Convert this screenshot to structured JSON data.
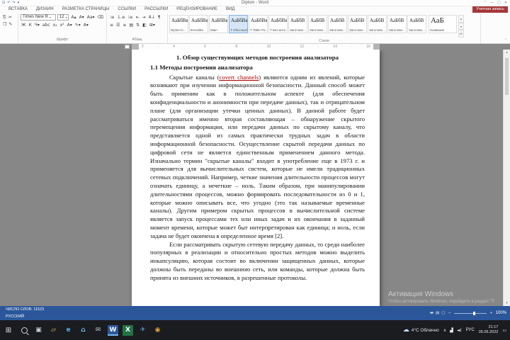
{
  "titlebar": {
    "title": "Diplom - Word",
    "qat": [
      {
        "g": "⊡",
        "n": "save-button"
      },
      {
        "g": "↶",
        "n": "undo-button"
      },
      {
        "g": "↷",
        "n": "redo-button"
      },
      {
        "g": "▾",
        "n": "qat-customize-button"
      }
    ],
    "controls": [
      {
        "g": "⌃",
        "n": "ribbon-display-options-button"
      },
      {
        "g": "—",
        "n": "minimize-button"
      },
      {
        "g": "▢",
        "n": "restore-button"
      },
      {
        "g": "✕",
        "n": "close-button"
      }
    ]
  },
  "ribbon": {
    "tabs": [
      "ВСТАВКА",
      "ДИЗАЙН",
      "РАЗМЕТКА СТРАНИЦЫ",
      "ССЫЛКИ",
      "РАССЫЛКИ",
      "РЕЦЕНЗИРОВАНИЕ",
      "ВИД"
    ],
    "account_label": "Учетная запись",
    "clipboard": {
      "icons": [
        {
          "g": "⎘",
          "n": "paste-icon"
        },
        {
          "g": "✂",
          "n": "cut-icon"
        },
        {
          "g": "❐",
          "n": "copy-icon"
        },
        {
          "g": "✎",
          "n": "format-painter-icon"
        }
      ]
    },
    "font": {
      "label": "Шрифт",
      "font_name": "Times New R",
      "font_size": "12",
      "row1_buttons": [
        {
          "g": "А▴",
          "n": "grow-font-button"
        },
        {
          "g": "А▾",
          "n": "shrink-font-button"
        },
        {
          "g": "Аа▾",
          "n": "change-case-button"
        },
        {
          "g": "⌫",
          "n": "clear-formatting-button"
        }
      ],
      "row2_buttons": [
        {
          "g": "Ж",
          "n": "bold-button"
        },
        {
          "g": "К",
          "n": "italic-button"
        },
        {
          "g": "Ч▾",
          "n": "underline-button"
        },
        {
          "g": "abc",
          "n": "strikethrough-button"
        },
        {
          "g": "х₂",
          "n": "subscript-button"
        },
        {
          "g": "х²",
          "n": "superscript-button"
        },
        {
          "g": "А▾",
          "n": "text-effects-button"
        },
        {
          "g": "✎▾",
          "n": "highlight-button"
        },
        {
          "g": "А▾",
          "n": "font-color-button"
        }
      ]
    },
    "paragraph": {
      "label": "Абзац",
      "row1_buttons": [
        {
          "g": "∶≡",
          "n": "bullets-button"
        },
        {
          "g": "⒈≡",
          "n": "numbering-button"
        },
        {
          "g": "⁝≡",
          "n": "multilevel-list-button"
        },
        {
          "g": "⇤",
          "n": "decrease-indent-button"
        },
        {
          "g": "⇥",
          "n": "increase-indent-button"
        },
        {
          "g": "А↓",
          "n": "sort-button"
        },
        {
          "g": "¶",
          "n": "show-marks-button"
        }
      ],
      "row2_buttons": [
        {
          "g": "≡",
          "n": "align-left-button"
        },
        {
          "g": "☰",
          "n": "align-center-button"
        },
        {
          "g": "≡",
          "n": "align-right-button"
        },
        {
          "g": "▤",
          "n": "justify-button"
        },
        {
          "g": "⇅",
          "n": "line-spacing-button"
        },
        {
          "g": "◧",
          "n": "shading-button"
        },
        {
          "g": "⊞▾",
          "n": "borders-button"
        }
      ]
    },
    "styles": {
      "label": "Стили",
      "tiles": [
        {
          "sample": "АаБбВвГ",
          "name": "Diplom b..."
        },
        {
          "sample": "АаБбВв",
          "name": "krevedko"
        },
        {
          "sample": "АаБбВв",
          "name": "Main"
        },
        {
          "sample": "АаБбВвГ,",
          "name": "Т Обычный",
          "selected": true
        },
        {
          "sample": "АаБбВвГ,",
          "name": "Т Table Pa..."
        },
        {
          "sample": "АаБбВвГ,",
          "name": "Т Без инте..."
        },
        {
          "sample": "АаБбВ",
          "name": "Заголово..."
        },
        {
          "sample": "АаБбВ",
          "name": "Заголово..."
        },
        {
          "sample": "АаБбВ",
          "name": "Заголово..."
        },
        {
          "sample": "АаБбВ",
          "name": "Заголово..."
        },
        {
          "sample": "АаБбВ",
          "name": "Заголово..."
        },
        {
          "sample": "АаБбВ",
          "name": "Заголово..."
        },
        {
          "sample": "АаБбВ",
          "name": "Заголово..."
        }
      ],
      "big": {
        "sample": "АаБ",
        "name": "Название"
      },
      "arrows": [
        {
          "g": "▴",
          "n": "style-gallery-up-button"
        },
        {
          "g": "▾",
          "n": "style-gallery-down-button"
        },
        {
          "g": "▾≡",
          "n": "style-gallery-more-button"
        }
      ]
    }
  },
  "ruler": {
    "numbers": [
      "2",
      "·",
      "4",
      "·",
      "6",
      "·",
      "8",
      "·",
      "10",
      "·",
      "12",
      "·",
      "14",
      "·",
      "16"
    ]
  },
  "doc": {
    "heading": "1. Обзор существующих методов построения анализатора",
    "subheading": "1.1 Методы построения анализатора",
    "p1_before": "Скрытые каналы (",
    "p1_link": "covert channels",
    "p1_after": ") являются одним из явлений, которые возникают при изучении информационной безопасности. Данный способ может быть применим как в положительном аспекте (для обеспечения конфиденциальности и анонимности при передаче данных), так и отрицательном плане (для организации утечки ценных данных). В данной работе будет рассматриваться именно вторая составляющая – обнаружение скрытого перемещения информации, или передачи данных по скрытому каналу, что представляется одной из самых практически трудных задач в области информационной безопасности. Осуществление скрытой передачи данных по цифровой сети не является единственным применением данного метода. Изначально термин \"скрытые каналы\" входит в употребление еще в 1973 г. и применяется для вычислительных систем, которые не имели традиционных сетевых подключений. Например, четкие значения длительности процессов могут означать единицу, а нечеткие – ноль. Таким образом, при манипулировании длительностями процессов, можно формировать последовательности из 0 и 1, которые можно описывать все, что угодно (это так называемые временные каналы). Другим примером скрытых процессов в вычислительной системе является запуск процессами тех или иных задач и их окончания в заданный момент времени, которые может быт интерпретирован как единица; и ноль, если задача не будет окончена в определенное время [2].",
    "p2": "Если рассматривать скрытую сетевую передачу данных, то среди наиболее популярных в реализации и относительно простых методов можно выделить инкапсуляцию, которая состоит во включении защищенных данных, которые должны быть переданы во внешнюю сеть, или команды, которые должна быть принята из внешних источников, в разрешенные протоколы."
  },
  "watermark": {
    "title": "Активация Windows",
    "subtitle": "Чтобы активировать Windows, перейдите в раздел \"П"
  },
  "statusbar": {
    "words": "ЧИСЛО СЛОВ: 11523",
    "language": "РУССКИЙ",
    "zoom": "100%",
    "view_icons": [
      {
        "g": "▬",
        "n": "read-mode-button"
      },
      {
        "g": "▤",
        "n": "print-layout-button"
      },
      {
        "g": "▢",
        "n": "web-layout-button"
      }
    ]
  },
  "taskbar": {
    "start_glyph": "⊞",
    "apps": [
      {
        "g": "▣",
        "n": "task-view-button",
        "c": "#C9D1D9"
      },
      {
        "g": "▱",
        "n": "file-explorer-icon",
        "c": "#E9C46A"
      },
      {
        "g": "e",
        "n": "edge-icon",
        "c": "#58B0E8"
      },
      {
        "g": "⌂",
        "n": "store-icon",
        "c": "#69C8F2"
      },
      {
        "g": "✉",
        "n": "mail-icon",
        "c": "#B8C4CE"
      },
      {
        "g": "W",
        "n": "word-icon",
        "c": "#FFFFFF",
        "bg": "#2B579A",
        "active": true
      },
      {
        "g": "X",
        "n": "excel-icon",
        "c": "#FFFFFF",
        "bg": "#217346"
      },
      {
        "g": "✈",
        "n": "telegram-icon",
        "c": "#54A9E0"
      },
      {
        "g": "◉",
        "n": "browser-icon",
        "c": "#E8A33D"
      }
    ],
    "weather": {
      "icon": "☁",
      "text": "4°C Облачно"
    },
    "tray_icons": [
      {
        "g": "∧",
        "n": "tray-expand-button"
      },
      {
        "g": "▟",
        "n": "network-icon"
      },
      {
        "g": "◄)",
        "n": "volume-icon"
      }
    ],
    "language": "РУС",
    "time": "21:17",
    "date": "05.05.2022",
    "action_center_glyph": "▭"
  }
}
